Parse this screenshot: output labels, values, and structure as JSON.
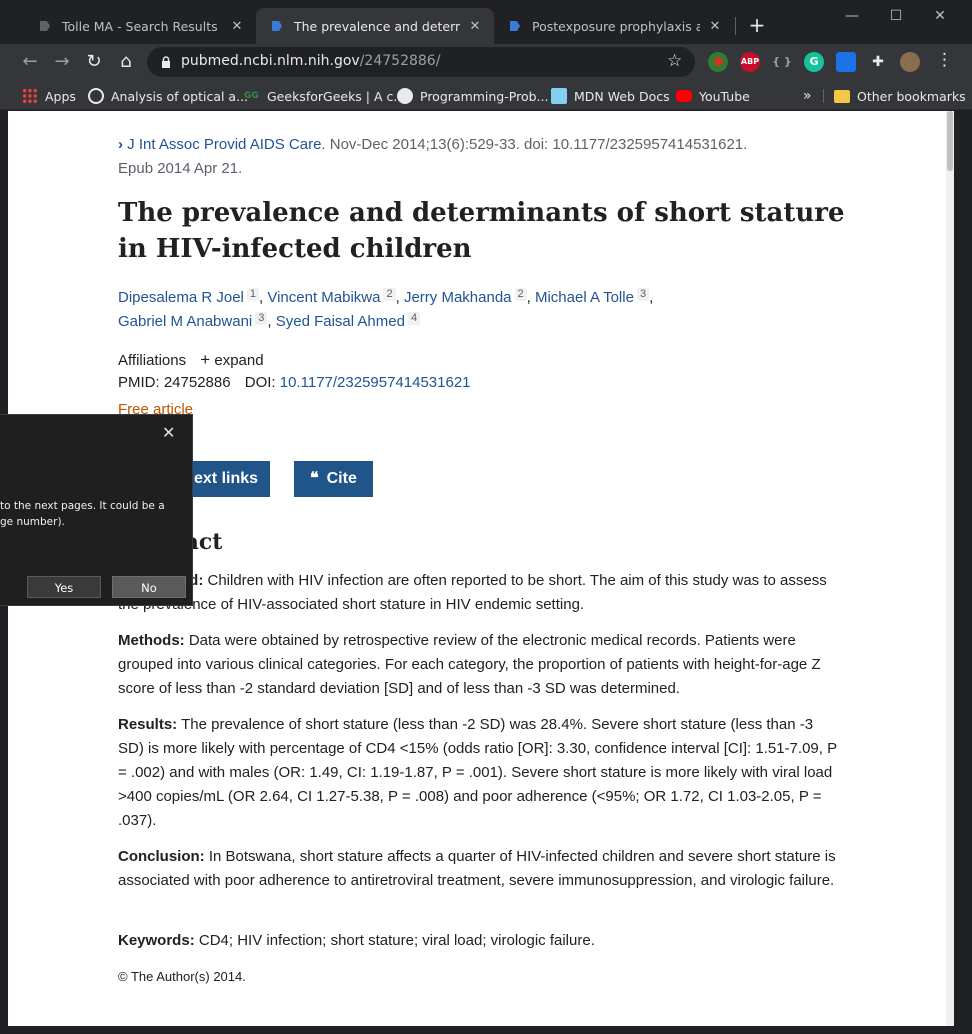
{
  "tabs": [
    {
      "title": "Tolle MA - Search Results - PubM",
      "active": false
    },
    {
      "title": "The prevalence and determinants",
      "active": true
    },
    {
      "title": "Postexposure prophylaxis against",
      "active": false
    }
  ],
  "window_controls": {
    "minimize": "—",
    "maximize": "☐",
    "close": "✕"
  },
  "address_bar": {
    "domain": "pubmed.ncbi.nlm.nih.gov",
    "path": "/24752886/"
  },
  "extensions": [
    {
      "name": "record-icon",
      "label": "",
      "color": "#d93025"
    },
    {
      "name": "adblock-icon",
      "label": "ABP",
      "color": "#c70d2c"
    },
    {
      "name": "json-icon",
      "label": "{ }",
      "color": "#35363a"
    },
    {
      "name": "grammarly-icon",
      "label": "G",
      "color": "#15c39a"
    },
    {
      "name": "share-icon",
      "label": "",
      "color": "#1a73e8"
    },
    {
      "name": "puzzle-icon",
      "label": "",
      "color": "#35363a"
    },
    {
      "name": "profile-icon",
      "label": "",
      "color": "#8a6d4f"
    }
  ],
  "bookmarks": {
    "items": [
      "Apps",
      "Analysis of optical a...",
      "GeeksforGeeks | A c...",
      "Programming-Prob...",
      "MDN Web Docs",
      "YouTube"
    ],
    "overflow": "»",
    "other": "Other bookmarks"
  },
  "article": {
    "journal_link": "J Int Assoc Provid AIDS Care",
    "citation": ". Nov-Dec 2014;13(6):529-33. doi: 10.1177/2325957414531621.",
    "epub": "Epub 2014 Apr 21.",
    "title": "The prevalence and determinants of short stature in HIV-infected children",
    "authors": [
      {
        "name": "Dipesalema R Joel",
        "aff": "1"
      },
      {
        "name": "Vincent Mabikwa",
        "aff": "2"
      },
      {
        "name": "Jerry Makhanda",
        "aff": "2"
      },
      {
        "name": "Michael A Tolle",
        "aff": "3"
      },
      {
        "name": "Gabriel M Anabwani",
        "aff": "3"
      },
      {
        "name": "Syed Faisal Ahmed",
        "aff": "4"
      }
    ],
    "affiliations_label": "Affiliations",
    "expand_label": "expand",
    "pmid_label": "PMID: 24752886",
    "doi_label": "DOI:",
    "doi_link": "10.1177/2325957414531621",
    "free_article": "Free article",
    "full_text_button": "ext links",
    "cite_button": "Cite",
    "abstract_heading": "Abstract",
    "background_tail": "nd:",
    "background_text": "Children with HIV infection are often reported to be short. The aim of this study was to assess the prevalence of HIV-associated short stature in HIV endemic setting.",
    "methods_label": "Methods:",
    "methods_text": "Data were obtained by retrospective review of the electronic medical records. Patients were grouped into various clinical categories. For each category, the proportion of patients with height-for-age Z score of less than -2 standard deviation [SD] and of less than -3 SD was determined.",
    "results_label": "Results:",
    "results_text": "The prevalence of short stature (less than -2 SD) was 28.4%. Severe short stature (less than -3 SD) is more likely with percentage of CD4 <15% (odds ratio [OR]: 3.30, confidence interval [CI]: 1.51-7.09, P = .002) and with males (OR: 1.49, CI: 1.19-1.87, P = .001). Severe short stature is more likely with viral load >400 copies/mL (OR 2.64, CI 1.27-5.38, P = .008) and poor adherence (<95%; OR 1.72, CI 1.03-2.05, P = .037).",
    "conclusion_label": "Conclusion:",
    "conclusion_text": "In Botswana, short stature affects a quarter of HIV-infected children and severe short stature is associated with poor adherence to antiretroviral treatment, severe immunosuppression, and virologic failure.",
    "keywords_label": "Keywords:",
    "keywords_text": "CD4; HIV infection; short stature; viral load; virologic failure.",
    "copyright": "© The Author(s) 2014."
  },
  "dialog": {
    "line1": "to the next pages. It could be a",
    "line2": "ge number).",
    "yes": "Yes",
    "no": "No",
    "close": "✕"
  }
}
